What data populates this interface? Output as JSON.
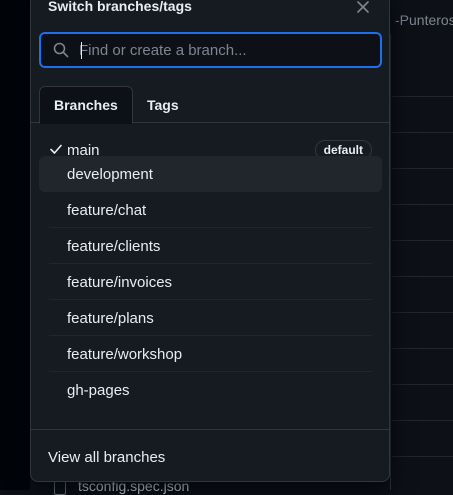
{
  "background": {
    "header_text": "-Punteros",
    "file_name": "tsconfig.spec.json"
  },
  "popover": {
    "title": "Switch branches/tags",
    "close_icon": "close-icon",
    "search": {
      "placeholder": "Find or create a branch...",
      "value": ""
    },
    "tabs": [
      {
        "label": "Branches",
        "active": true
      },
      {
        "label": "Tags",
        "active": false
      }
    ],
    "branches": [
      {
        "label": "main",
        "checked": true,
        "badge": "default"
      },
      {
        "label": "development",
        "highlighted": true
      },
      {
        "label": "feature/chat"
      },
      {
        "label": "feature/clients"
      },
      {
        "label": "feature/invoices"
      },
      {
        "label": "feature/plans"
      },
      {
        "label": "feature/workshop"
      },
      {
        "label": "gh-pages"
      }
    ],
    "footer_link": "View all branches"
  },
  "colors": {
    "accent": "#1f6feb",
    "panel": "#161b22",
    "page": "#0d1117"
  }
}
